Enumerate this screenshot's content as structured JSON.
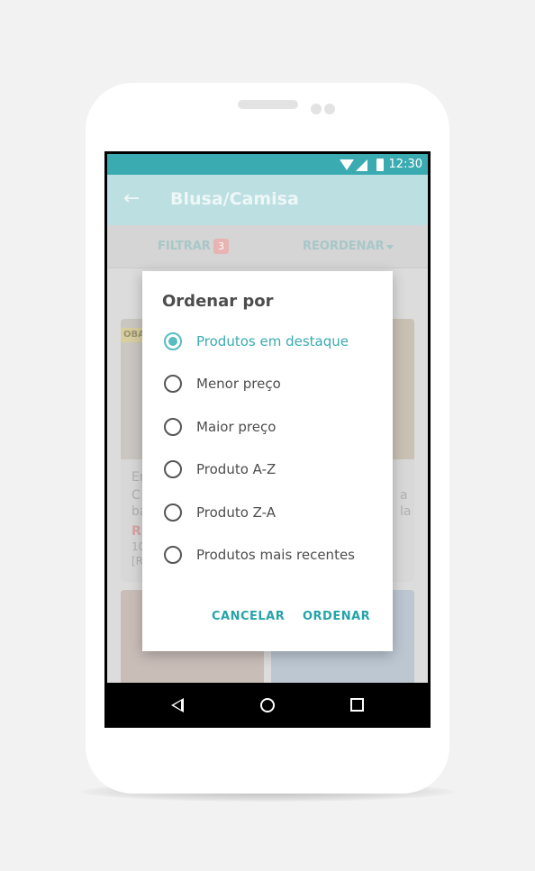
{
  "status_bar": {
    "time": "12:30"
  },
  "app": {
    "title": "Blusa/Camisa",
    "filter_label": "FILTRAR",
    "filter_count": "3",
    "sort_label": "REORDENAR"
  },
  "background_cards": {
    "badge": "OBA",
    "left_fragments": [
      "Er",
      "C",
      "ba",
      "R",
      "10",
      "[R"
    ],
    "right_fragments": [
      "a",
      "la"
    ]
  },
  "dialog": {
    "title": "Ordenar por",
    "options": [
      {
        "label": "Produtos em destaque",
        "selected": true
      },
      {
        "label": "Menor preço",
        "selected": false
      },
      {
        "label": "Maior preço",
        "selected": false
      },
      {
        "label": "Produto A-Z",
        "selected": false
      },
      {
        "label": "Produto Z-A",
        "selected": false
      },
      {
        "label": "Produtos mais recentes",
        "selected": false
      }
    ],
    "cancel_label": "CANCELAR",
    "confirm_label": "ORDENAR"
  },
  "colors": {
    "accent": "#3aabb1",
    "toolbar_dimmed": "#bcdfe1",
    "text_primary": "#4d4d4d",
    "background": "#f2f2f2"
  },
  "icons": {
    "back": "arrow-back-icon",
    "wifi": "wifi-icon",
    "signal": "cell-signal-icon",
    "battery": "battery-icon",
    "nav_back": "nav-back-icon",
    "nav_home": "nav-home-icon",
    "nav_recents": "nav-recents-icon"
  }
}
